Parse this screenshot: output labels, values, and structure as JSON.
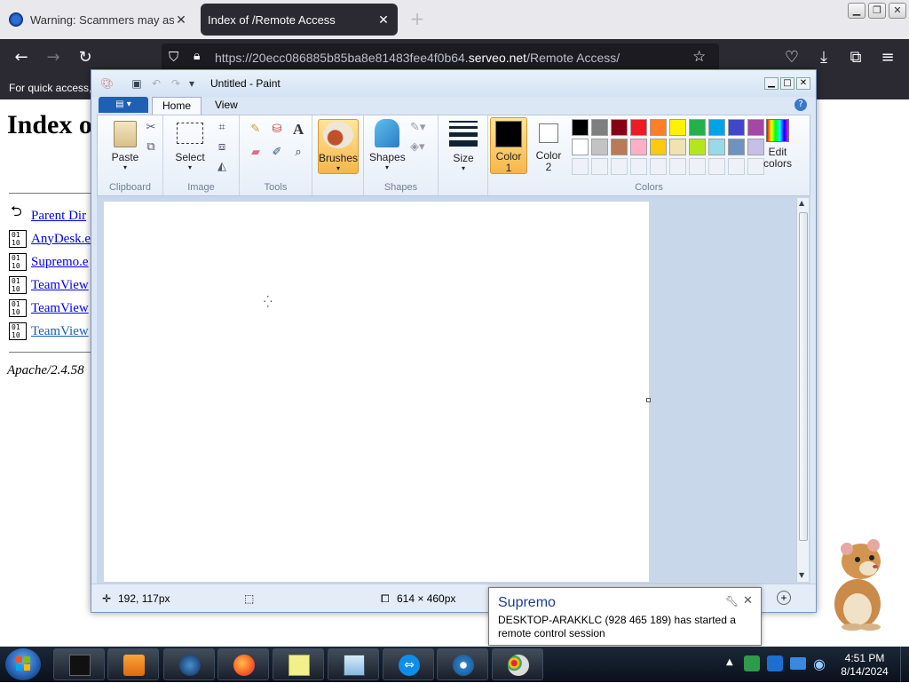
{
  "browser": {
    "tabs": [
      {
        "title": "Warning: Scammers may ask y",
        "active": false
      },
      {
        "title": "Index of /Remote Access",
        "active": true
      }
    ],
    "url": {
      "prefix": "https://20ecc086885b85ba8e81483fee4f0b64.",
      "domain": "serveo.net",
      "path": "/Remote Access/"
    },
    "bookmarks_text": "For quick access,"
  },
  "page": {
    "heading": "Index o",
    "rows": [
      {
        "label": "Parent Dir",
        "icon": "back-arrow-icon"
      },
      {
        "label": "AnyDesk.e",
        "icon": "binary-file-icon"
      },
      {
        "label": "Supremo.e",
        "icon": "binary-file-icon"
      },
      {
        "label": "TeamView",
        "icon": "binary-file-icon"
      },
      {
        "label": "TeamView",
        "icon": "binary-file-icon"
      },
      {
        "label": "TeamView",
        "icon": "binary-file-icon"
      }
    ],
    "footer": "Apache/2.4.58"
  },
  "paint": {
    "title": "Untitled - Paint",
    "tabs": {
      "home": "Home",
      "view": "View"
    },
    "groups": {
      "clipboard": {
        "label": "Clipboard",
        "paste": "Paste"
      },
      "image": {
        "label": "Image",
        "select": "Select"
      },
      "tools": {
        "label": "Tools"
      },
      "brushes": {
        "label": "Brushes"
      },
      "shapes": {
        "label": "Shapes",
        "button": "Shapes"
      },
      "size": {
        "label": "Size"
      },
      "colors": {
        "label": "Colors",
        "color1": "Color 1",
        "color2": "Color 2",
        "edit": "Edit colors"
      }
    },
    "palette_row1": [
      "#000000",
      "#7f7f7f",
      "#880015",
      "#ed1c24",
      "#ff7f27",
      "#fff200",
      "#22b14c",
      "#00a2e8",
      "#3f48cc",
      "#a349a4"
    ],
    "palette_row2": [
      "#ffffff",
      "#c3c3c3",
      "#b97a57",
      "#ffaec9",
      "#ffc90e",
      "#efe4b0",
      "#b5e61d",
      "#99d9ea",
      "#7092be",
      "#c8bfe7"
    ],
    "color1": "#000000",
    "color2": "#ffffff",
    "status": {
      "cursor_pos": "192, 117px",
      "canvas_size": "614 × 460px"
    }
  },
  "notification": {
    "app": "Supremo",
    "message": "DESKTOP-ARAKKLC (928 465 189) has started a remote control session"
  },
  "taskbar": {
    "time": "4:51 PM",
    "date": "8/14/2024"
  }
}
